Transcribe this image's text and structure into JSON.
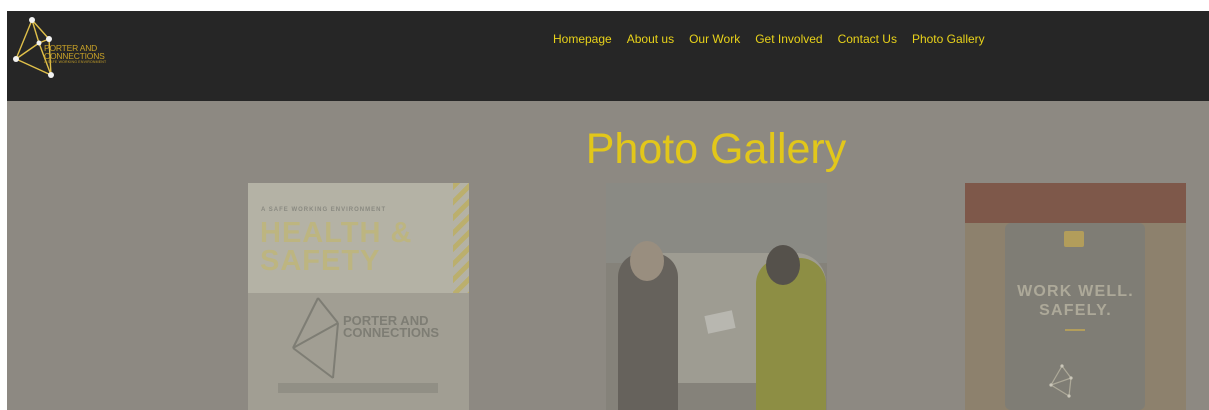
{
  "header": {
    "logo": {
      "line1": "PORTER AND",
      "line2": "CONNECTIONS",
      "tagline": "A SAFE WORKING ENVIRONMENT"
    },
    "nav": [
      {
        "label": "Homepage"
      },
      {
        "label": "About us"
      },
      {
        "label": "Our Work"
      },
      {
        "label": "Get Involved"
      },
      {
        "label": "Contact Us"
      },
      {
        "label": "Photo Gallery"
      }
    ]
  },
  "main": {
    "title": "Photo Gallery",
    "gallery": [
      {
        "small": "A SAFE WORKING ENVIRONMENT",
        "headline_1": "HEALTH &",
        "headline_2": "SAFETY",
        "brand_1": "PORTER AND",
        "brand_2": "CONNECTIONS"
      },
      {},
      {
        "headline_1": "WORK WELL.",
        "headline_2": "SAFELY."
      }
    ]
  },
  "colors": {
    "header_bg": "#262626",
    "page_bg": "#8d8982",
    "accent": "#e2c71a",
    "logo_gold": "#c9a227"
  }
}
